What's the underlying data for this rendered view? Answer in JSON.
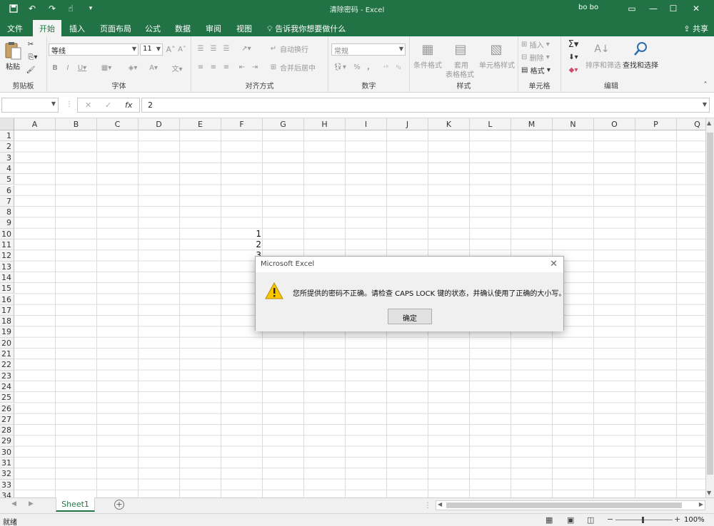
{
  "app": {
    "window_title": "清除密码 - Excel",
    "user": "bo bo",
    "share_label": "共享",
    "tell_me": "告诉我你想要做什么"
  },
  "tabs": [
    "文件",
    "开始",
    "插入",
    "页面布局",
    "公式",
    "数据",
    "审阅",
    "视图"
  ],
  "active_tab": "开始",
  "ribbon": {
    "clipboard": {
      "label": "剪贴板",
      "paste": "粘贴"
    },
    "font": {
      "label": "字体",
      "font_name": "等线",
      "font_size": "11"
    },
    "alignment": {
      "label": "对齐方式",
      "wrap": "自动换行",
      "merge": "合并后居中"
    },
    "number": {
      "label": "数字",
      "format": "常规",
      "percent": "%",
      "comma": ","
    },
    "styles": {
      "label": "样式",
      "conditional": "条件格式",
      "table1": "套用",
      "table2": "表格格式",
      "cell_styles": "单元格样式"
    },
    "cells": {
      "label": "单元格",
      "insert": "插入",
      "delete": "删除",
      "format": "格式"
    },
    "editing": {
      "label": "编辑",
      "sort": "排序和筛选",
      "find": "查找和选择"
    }
  },
  "formula_bar": {
    "name_box": "",
    "fx": "fx",
    "value": "2"
  },
  "grid": {
    "columns": [
      "A",
      "B",
      "C",
      "D",
      "E",
      "F",
      "G",
      "H",
      "I",
      "J",
      "K",
      "L",
      "M",
      "N",
      "O",
      "P",
      "Q"
    ],
    "rows": [
      "1",
      "2",
      "3",
      "4",
      "5",
      "6",
      "7",
      "8",
      "9",
      "10",
      "11",
      "12",
      "13",
      "14",
      "15",
      "16",
      "17",
      "18",
      "19",
      "20",
      "21",
      "22",
      "23",
      "24",
      "25",
      "26",
      "27",
      "28",
      "29",
      "30",
      "31",
      "32",
      "33",
      "34"
    ],
    "cells": [
      {
        "ref": "F10",
        "value": "1"
      },
      {
        "ref": "F11",
        "value": "2"
      },
      {
        "ref": "F12",
        "value": "3"
      }
    ]
  },
  "sheet_tabs": [
    "Sheet1"
  ],
  "status": {
    "ready": "就绪",
    "zoom": "100%"
  },
  "dialog": {
    "title": "Microsoft Excel",
    "message": "您所提供的密码不正确。请检查 CAPS LOCK 键的状态，并确认使用了正确的大小写。",
    "ok_label": "确定"
  },
  "colors": {
    "excel_green": "#217346",
    "warning_yellow": "#f7c600"
  }
}
